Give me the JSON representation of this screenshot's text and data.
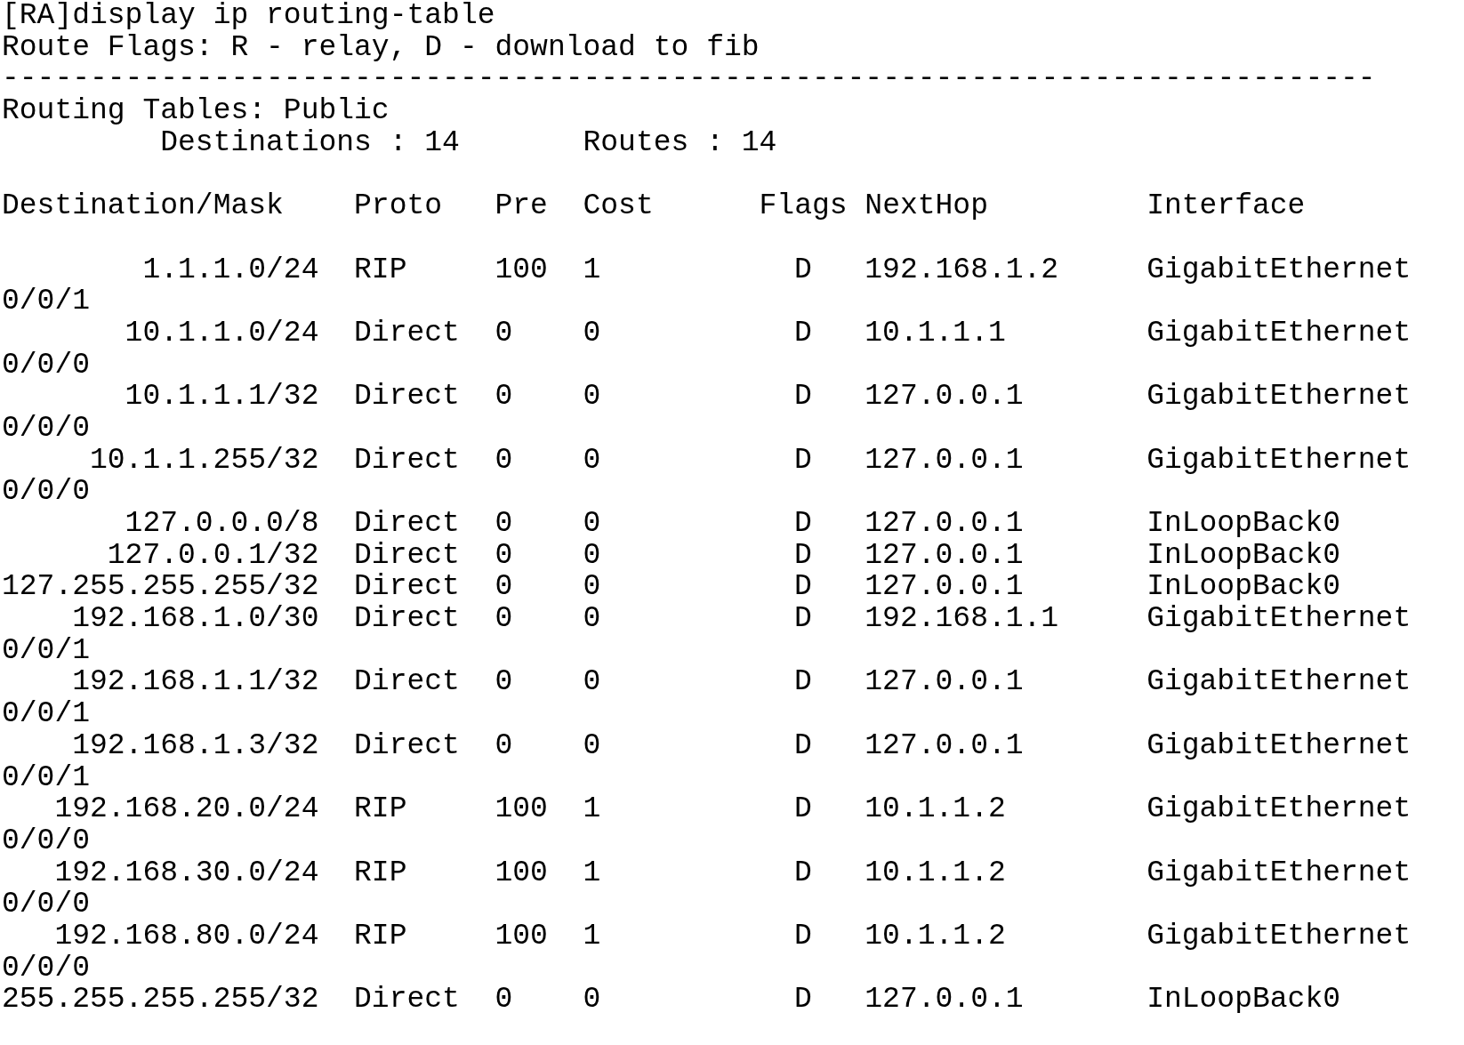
{
  "command": "[RA]display ip routing-table",
  "flags_legend": "Route Flags: R - relay, D - download to fib",
  "separator": "------------------------------------------------------------------------------",
  "table_name": "Routing Tables: Public",
  "summary": {
    "destinations": "Destinations : 14",
    "routes": "Routes : 14"
  },
  "columns": [
    "Destination/Mask",
    "Proto",
    "Pre",
    "Cost",
    "Flags",
    "NextHop",
    "Interface"
  ],
  "rows": [
    {
      "destination": "1.1.1.0/24",
      "proto": "RIP",
      "pre": "100",
      "cost": "1",
      "flags": "D",
      "nexthop": "192.168.1.2",
      "interface": "GigabitEthernet",
      "continuation": "0/0/1"
    },
    {
      "destination": "10.1.1.0/24",
      "proto": "Direct",
      "pre": "0",
      "cost": "0",
      "flags": "D",
      "nexthop": "10.1.1.1",
      "interface": "GigabitEthernet",
      "continuation": "0/0/0"
    },
    {
      "destination": "10.1.1.1/32",
      "proto": "Direct",
      "pre": "0",
      "cost": "0",
      "flags": "D",
      "nexthop": "127.0.0.1",
      "interface": "GigabitEthernet",
      "continuation": "0/0/0"
    },
    {
      "destination": "10.1.1.255/32",
      "proto": "Direct",
      "pre": "0",
      "cost": "0",
      "flags": "D",
      "nexthop": "127.0.0.1",
      "interface": "GigabitEthernet",
      "continuation": "0/0/0"
    },
    {
      "destination": "127.0.0.0/8",
      "proto": "Direct",
      "pre": "0",
      "cost": "0",
      "flags": "D",
      "nexthop": "127.0.0.1",
      "interface": "InLoopBack0"
    },
    {
      "destination": "127.0.0.1/32",
      "proto": "Direct",
      "pre": "0",
      "cost": "0",
      "flags": "D",
      "nexthop": "127.0.0.1",
      "interface": "InLoopBack0"
    },
    {
      "destination": "127.255.255.255/32",
      "proto": "Direct",
      "pre": "0",
      "cost": "0",
      "flags": "D",
      "nexthop": "127.0.0.1",
      "interface": "InLoopBack0"
    },
    {
      "destination": "192.168.1.0/30",
      "proto": "Direct",
      "pre": "0",
      "cost": "0",
      "flags": "D",
      "nexthop": "192.168.1.1",
      "interface": "GigabitEthernet",
      "continuation": "0/0/1"
    },
    {
      "destination": "192.168.1.1/32",
      "proto": "Direct",
      "pre": "0",
      "cost": "0",
      "flags": "D",
      "nexthop": "127.0.0.1",
      "interface": "GigabitEthernet",
      "continuation": "0/0/1"
    },
    {
      "destination": "192.168.1.3/32",
      "proto": "Direct",
      "pre": "0",
      "cost": "0",
      "flags": "D",
      "nexthop": "127.0.0.1",
      "interface": "GigabitEthernet",
      "continuation": "0/0/1"
    },
    {
      "destination": "192.168.20.0/24",
      "proto": "RIP",
      "pre": "100",
      "cost": "1",
      "flags": "D",
      "nexthop": "10.1.1.2",
      "interface": "GigabitEthernet",
      "continuation": "0/0/0"
    },
    {
      "destination": "192.168.30.0/24",
      "proto": "RIP",
      "pre": "100",
      "cost": "1",
      "flags": "D",
      "nexthop": "10.1.1.2",
      "interface": "GigabitEthernet",
      "continuation": "0/0/0"
    },
    {
      "destination": "192.168.80.0/24",
      "proto": "RIP",
      "pre": "100",
      "cost": "1",
      "flags": "D",
      "nexthop": "10.1.1.2",
      "interface": "GigabitEthernet",
      "continuation": "0/0/0"
    },
    {
      "destination": "255.255.255.255/32",
      "proto": "Direct",
      "pre": "0",
      "cost": "0",
      "flags": "D",
      "nexthop": "127.0.0.1",
      "interface": "InLoopBack0"
    }
  ]
}
